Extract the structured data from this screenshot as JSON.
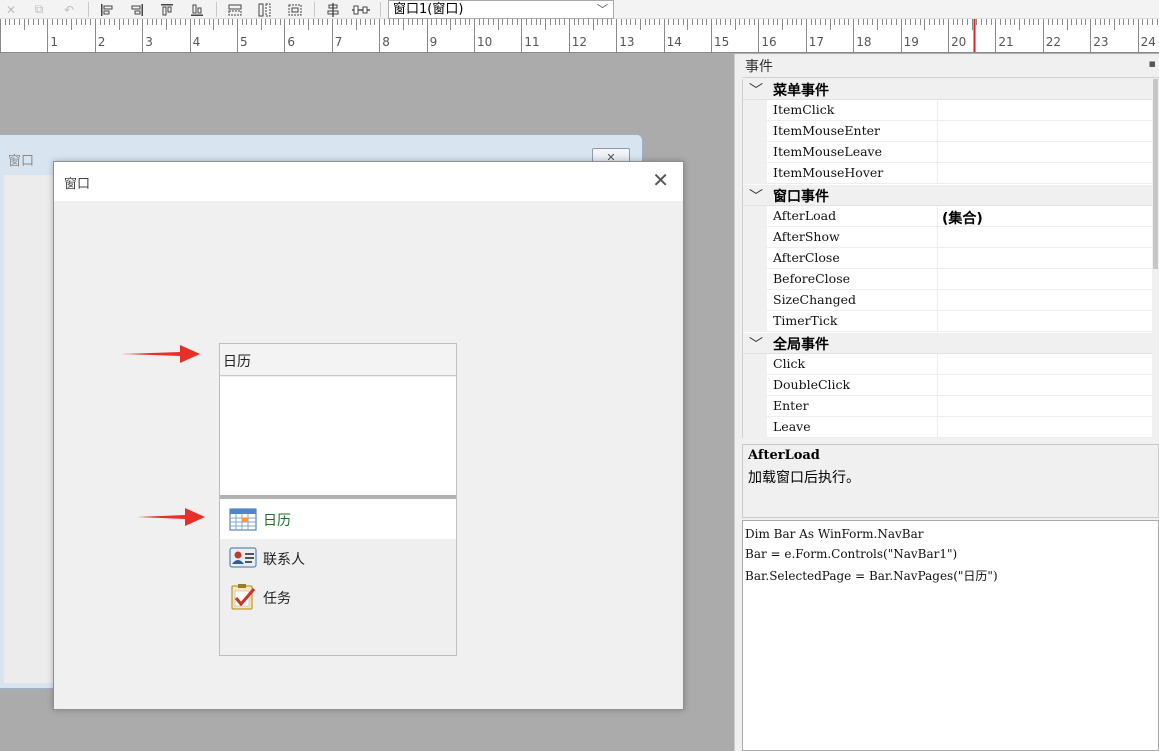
{
  "toolbar": {
    "icons": [
      "delete-icon",
      "group-icon",
      "undo-icon",
      "align-left-icon",
      "align-right-icon",
      "align-top-icon",
      "align-bottom-icon",
      "size-width-icon",
      "size-height-icon",
      "size-both-icon",
      "center-vertical-icon",
      "center-horizontal-icon"
    ],
    "object_selector": "窗口1(窗口)"
  },
  "ruler": {
    "numbers": [
      "1",
      "2",
      "3",
      "4",
      "5",
      "6",
      "7",
      "8",
      "9",
      "10",
      "11",
      "12",
      "13",
      "14",
      "15",
      "16",
      "17",
      "18",
      "19",
      "20",
      "21",
      "22",
      "23",
      "24"
    ]
  },
  "designer": {
    "background_window_title": "窗口",
    "window_title": "窗口",
    "navbar": {
      "header": "日历",
      "items": [
        {
          "label": "日历",
          "icon": "calendar-icon",
          "selected": true
        },
        {
          "label": "联系人",
          "icon": "contact-card-icon",
          "selected": false
        },
        {
          "label": "任务",
          "icon": "task-checklist-icon",
          "selected": false
        }
      ]
    },
    "arrow_color": "#e8302a"
  },
  "events_panel": {
    "title": "事件",
    "categories": [
      {
        "name": "菜单事件",
        "events": [
          {
            "name": "ItemClick",
            "value": ""
          },
          {
            "name": "ItemMouseEnter",
            "value": ""
          },
          {
            "name": "ItemMouseLeave",
            "value": ""
          },
          {
            "name": "ItemMouseHover",
            "value": ""
          }
        ]
      },
      {
        "name": "窗口事件",
        "events": [
          {
            "name": "AfterLoad",
            "value": "(集合)"
          },
          {
            "name": "AfterShow",
            "value": ""
          },
          {
            "name": "AfterClose",
            "value": ""
          },
          {
            "name": "BeforeClose",
            "value": ""
          },
          {
            "name": "SizeChanged",
            "value": ""
          },
          {
            "name": "TimerTick",
            "value": ""
          }
        ]
      },
      {
        "name": "全局事件",
        "events": [
          {
            "name": "Click",
            "value": ""
          },
          {
            "name": "DoubleClick",
            "value": ""
          },
          {
            "name": "Enter",
            "value": ""
          },
          {
            "name": "Leave",
            "value": ""
          }
        ]
      }
    ],
    "description": {
      "name": "AfterLoad",
      "text": "加载窗口后执行。"
    },
    "code": [
      "Dim Bar As WinForm.NavBar",
      "Bar = e.Form.Controls(\"NavBar1\")",
      "Bar.SelectedPage = Bar.NavPages(\"日历\")"
    ]
  }
}
